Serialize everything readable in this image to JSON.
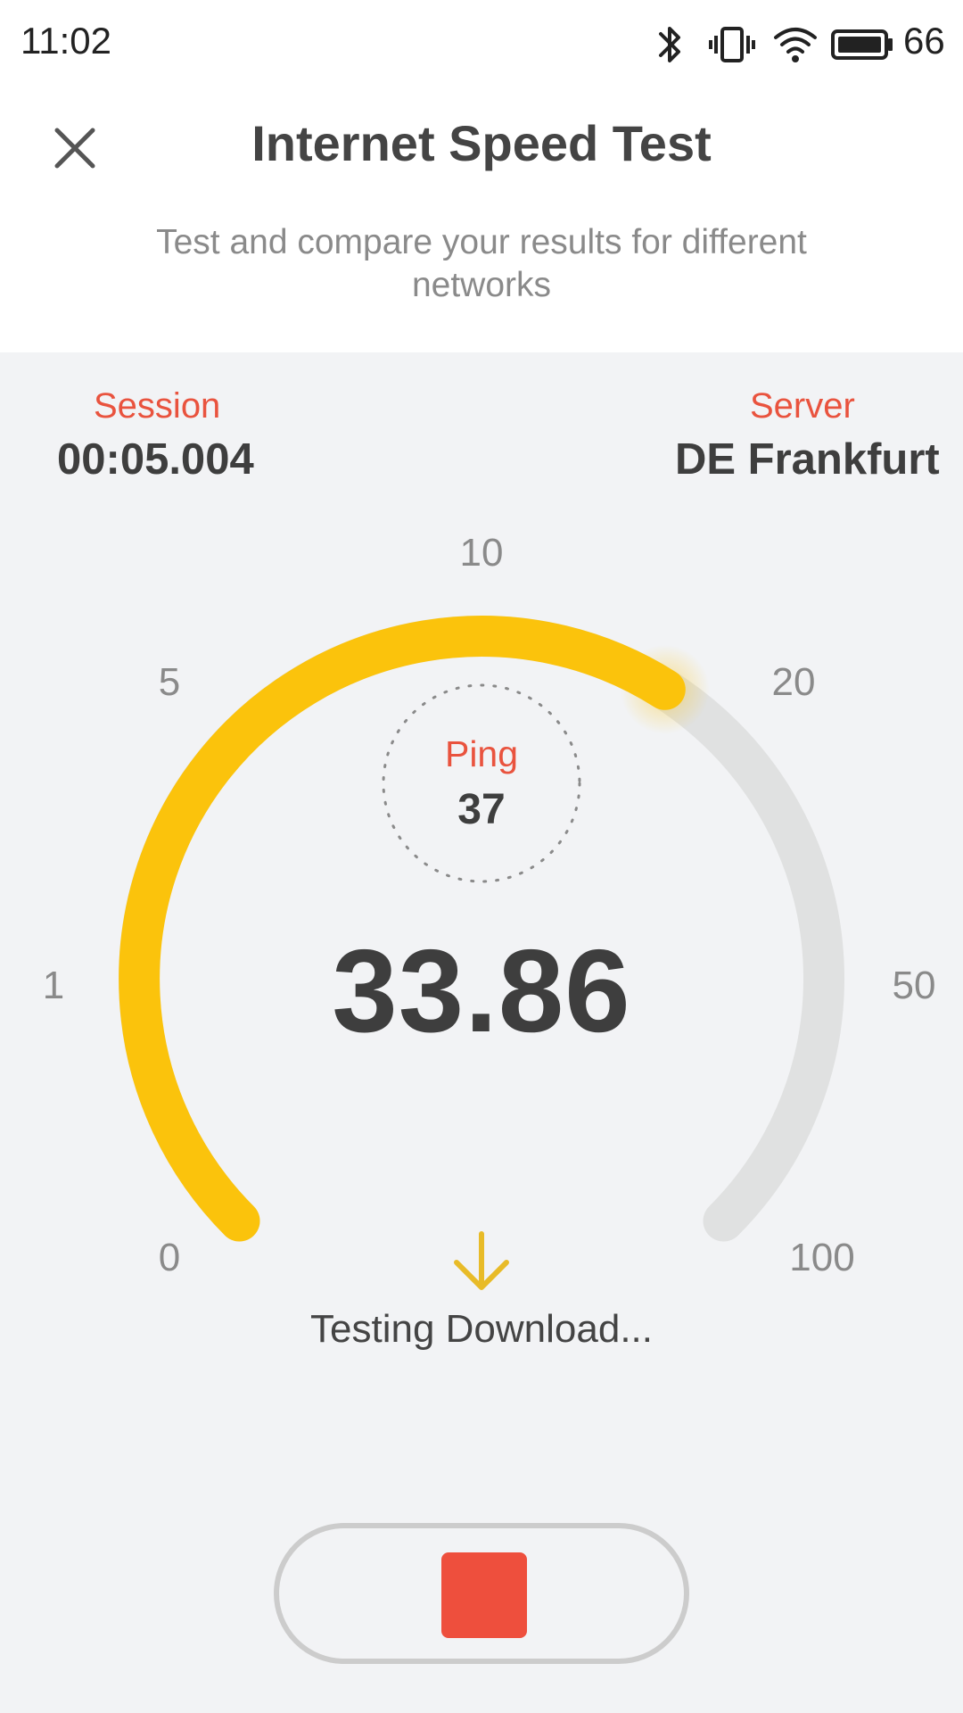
{
  "status_bar": {
    "time": "11:02",
    "battery_level": "66",
    "icons": [
      "bluetooth-icon",
      "vibrate-icon",
      "wifi-icon",
      "battery-icon"
    ]
  },
  "header": {
    "title": "Internet Speed Test",
    "subtitle": "Test and compare your results for different networks"
  },
  "session": {
    "label": "Session",
    "value": "00:05.004"
  },
  "server": {
    "label": "Server",
    "value": "DE Frankfurt"
  },
  "gauge": {
    "scale_labels": [
      "0",
      "1",
      "5",
      "10",
      "20",
      "50",
      "100"
    ],
    "progress_fraction": 0.62,
    "ping_label": "Ping",
    "ping_value": "37",
    "speed_value": "33.86",
    "status_text": "Testing Download..."
  },
  "colors": {
    "accent_red": "#e9533e",
    "gauge_yellow": "#fbc30c",
    "gauge_track": "#e0e1e1",
    "background": "#f2f3f5"
  }
}
